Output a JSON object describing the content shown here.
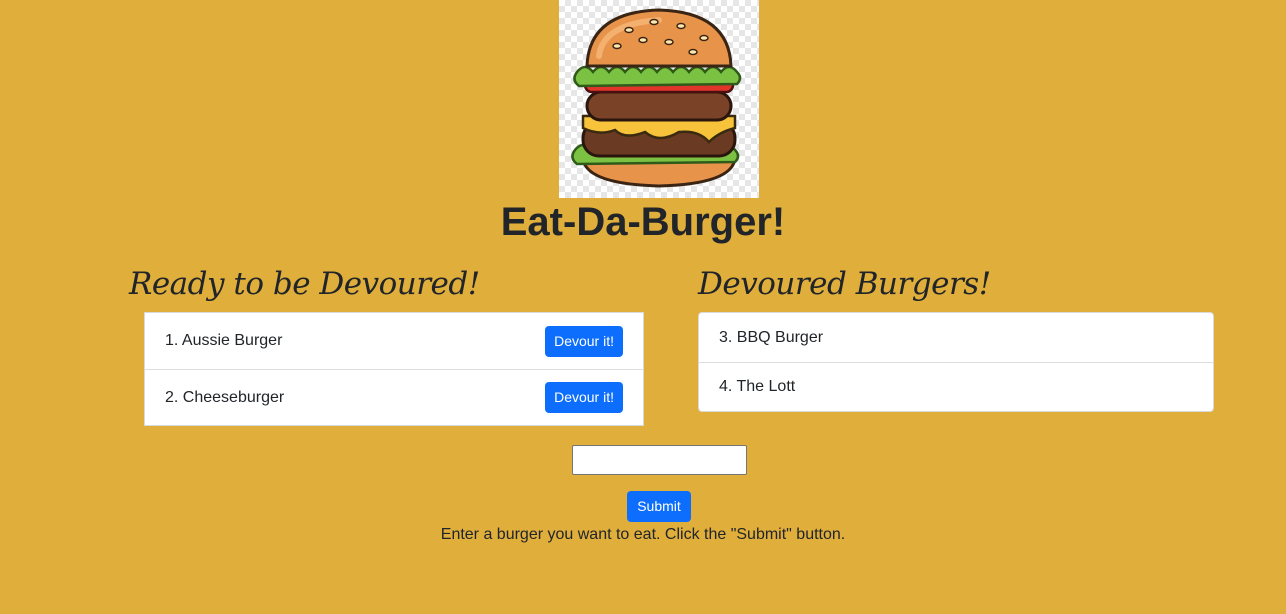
{
  "header": {
    "logo_icon": "burger-illustration",
    "title": "Eat-Da-Burger!"
  },
  "ready": {
    "heading": "Ready to be Devoured!",
    "items": [
      {
        "label": "1. Aussie Burger",
        "button": "Devour it!"
      },
      {
        "label": "2. Cheeseburger",
        "button": "Devour it!"
      }
    ]
  },
  "devoured": {
    "heading": "Devoured Burgers!",
    "items": [
      {
        "label": "3. BBQ Burger"
      },
      {
        "label": "4. The Lott"
      }
    ]
  },
  "form": {
    "input_value": "",
    "submit_label": "Submit",
    "instructions": "Enter a burger you want to eat. Click the \"Submit\" button."
  },
  "colors": {
    "background": "#E0AE3B",
    "primary_button": "#0d6efd"
  }
}
